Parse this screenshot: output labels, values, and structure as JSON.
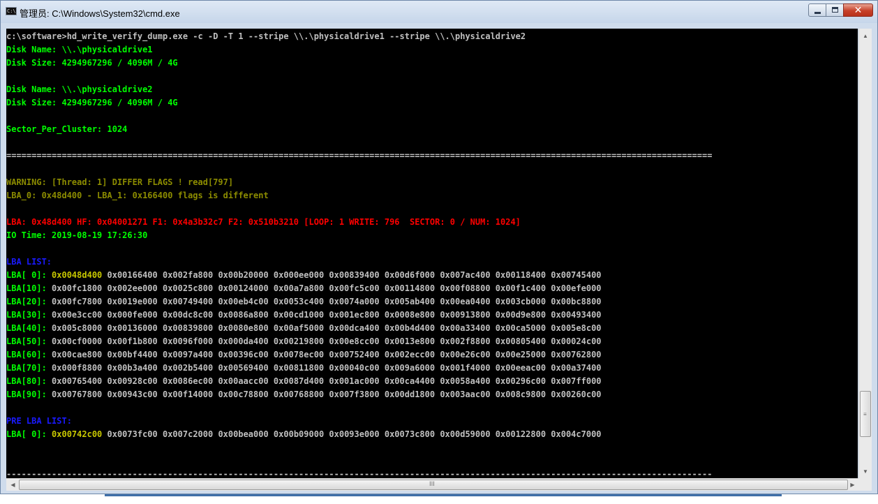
{
  "window": {
    "title": "管理员: C:\\Windows\\System32\\cmd.exe",
    "icon_text": "C:\\",
    "buttons": [
      "minimize",
      "maximize",
      "close"
    ]
  },
  "console": {
    "lines": [
      {
        "text": "c:\\software>hd_write_verify_dump.exe -c -D -T 1 --stripe \\\\.\\physicaldrive1 --stripe \\\\.\\physicaldrive2",
        "color": "white"
      },
      {
        "text": "Disk Name: \\\\.\\physicaldrive1",
        "color": "green"
      },
      {
        "text": "Disk Size: 4294967296 / 4096M / 4G",
        "color": "green"
      },
      {
        "text": "",
        "color": "green"
      },
      {
        "text": "Disk Name: \\\\.\\physicaldrive2",
        "color": "green"
      },
      {
        "text": "Disk Size: 4294967296 / 4096M / 4G",
        "color": "green"
      },
      {
        "text": "",
        "color": "green"
      },
      {
        "text": "Sector_Per_Cluster: 1024",
        "color": "green"
      },
      {
        "text": "",
        "color": "green"
      },
      {
        "text": "============================================================================================================================================",
        "color": "white"
      },
      {
        "text": "",
        "color": "white"
      },
      {
        "text": "WARNING: [Thread: 1] DIFFER FLAGS ! read[797]",
        "color": "olive"
      },
      {
        "text": "LBA_0: 0x48d400 - LBA_1: 0x166400 flags is different",
        "color": "olive"
      },
      {
        "text": "",
        "color": "white"
      },
      {
        "text": "LBA: 0x48d400 HF: 0x04001271 F1: 0x4a3b32c7 F2: 0x510b3210 [LOOP: 1 WRITE: 796  SECTOR: 0 / NUM: 1024]",
        "color": "red"
      },
      {
        "text": "IO Time: 2019-08-19 17:26:30",
        "color": "green"
      },
      {
        "text": "",
        "color": "white"
      },
      {
        "text": "LBA LIST:",
        "color": "blue"
      },
      {
        "segments": [
          {
            "text": "LBA[ 0]: ",
            "color": "green"
          },
          {
            "text": "0x0048d400",
            "color": "yellow"
          },
          {
            "text": " 0x00166400 0x002fa800 0x00b20000 0x000ee000 0x00839400 0x00d6f000 0x007ac400 0x00118400 0x00745400",
            "color": "white"
          }
        ]
      },
      {
        "segments": [
          {
            "text": "LBA[10]: ",
            "color": "green"
          },
          {
            "text": "0x00fc1800 0x002ee000 0x0025c800 0x00124000 0x00a7a800 0x00fc5c00 0x00114800 0x00f08800 0x00f1c400 0x00efe000",
            "color": "white"
          }
        ]
      },
      {
        "segments": [
          {
            "text": "LBA[20]: ",
            "color": "green"
          },
          {
            "text": "0x00fc7800 0x0019e000 0x00749400 0x00eb4c00 0x0053c400 0x0074a000 0x005ab400 0x00ea0400 0x003cb000 0x00bc8800",
            "color": "white"
          }
        ]
      },
      {
        "segments": [
          {
            "text": "LBA[30]: ",
            "color": "green"
          },
          {
            "text": "0x00e3cc00 0x000fe000 0x00dc8c00 0x0086a800 0x00cd1000 0x001ec800 0x0008e800 0x00913800 0x00d9e800 0x00493400",
            "color": "white"
          }
        ]
      },
      {
        "segments": [
          {
            "text": "LBA[40]: ",
            "color": "green"
          },
          {
            "text": "0x005c8000 0x00136000 0x00839800 0x0080e800 0x00af5000 0x00dca400 0x00b4d400 0x00a33400 0x00ca5000 0x005e8c00",
            "color": "white"
          }
        ]
      },
      {
        "segments": [
          {
            "text": "LBA[50]: ",
            "color": "green"
          },
          {
            "text": "0x00cf0000 0x00f1b800 0x0096f000 0x000da400 0x00219800 0x00e8cc00 0x0013e800 0x002f8800 0x00805400 0x00024c00",
            "color": "white"
          }
        ]
      },
      {
        "segments": [
          {
            "text": "LBA[60]: ",
            "color": "green"
          },
          {
            "text": "0x00cae800 0x00bf4400 0x0097a400 0x00396c00 0x0078ec00 0x00752400 0x002ecc00 0x00e26c00 0x00e25000 0x00762800",
            "color": "white"
          }
        ]
      },
      {
        "segments": [
          {
            "text": "LBA[70]: ",
            "color": "green"
          },
          {
            "text": "0x000f8800 0x00b3a400 0x002b5400 0x00569400 0x00811800 0x00040c00 0x009a6000 0x001f4000 0x00eeac00 0x00a37400",
            "color": "white"
          }
        ]
      },
      {
        "segments": [
          {
            "text": "LBA[80]: ",
            "color": "green"
          },
          {
            "text": "0x00765400 0x00928c00 0x0086ec00 0x00aacc00 0x0087d400 0x001ac000 0x00ca4400 0x0058a400 0x00296c00 0x007ff000",
            "color": "white"
          }
        ]
      },
      {
        "segments": [
          {
            "text": "LBA[90]: ",
            "color": "green"
          },
          {
            "text": "0x00767800 0x00943c00 0x00f14000 0x00c78800 0x00768800 0x007f3800 0x00dd1800 0x003aac00 0x008c9800 0x00260c00",
            "color": "white"
          }
        ]
      },
      {
        "text": "",
        "color": "white"
      },
      {
        "text": "PRE LBA LIST:",
        "color": "blue"
      },
      {
        "segments": [
          {
            "text": "LBA[ 0]: ",
            "color": "green"
          },
          {
            "text": "0x00742c00",
            "color": "yellow"
          },
          {
            "text": " 0x0073fc00 0x007c2000 0x00bea000 0x00b09000 0x0093e000 0x0073c800 0x00d59000 0x00122800 0x004c7000",
            "color": "white"
          }
        ]
      },
      {
        "text": "",
        "color": "white"
      },
      {
        "text": "",
        "color": "white"
      },
      {
        "text": "--------------------------------------------------------------------------------------------------------------------------------------------",
        "color": "white"
      }
    ]
  },
  "scrollbars": {
    "vertical_position": 0.83,
    "horizontal_grip": "III"
  },
  "colors": {
    "green": "#00ff00",
    "white": "#c0c0c0",
    "yellow": "#c8c800",
    "olive": "#8c8c00",
    "red": "#ff0000",
    "blue": "#1a1aff",
    "console_bg": "#000000"
  }
}
